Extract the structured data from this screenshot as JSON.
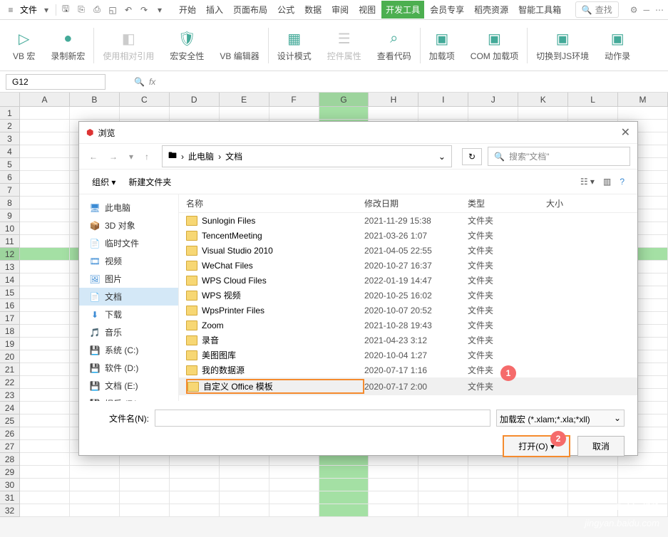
{
  "topbar": {
    "file": "文件",
    "tabs": [
      "开始",
      "插入",
      "页面布局",
      "公式",
      "数据",
      "审阅",
      "视图",
      "开发工具",
      "会员专享",
      "稻壳资源",
      "智能工具箱"
    ],
    "active_tab_index": 7,
    "search_placeholder": "查找"
  },
  "ribbon": [
    {
      "label": "VB 宏",
      "disabled": false
    },
    {
      "label": "录制新宏",
      "disabled": false
    },
    {
      "label": "使用相对引用",
      "disabled": true
    },
    {
      "label": "宏安全性",
      "disabled": false
    },
    {
      "label": "VB 编辑器",
      "disabled": false
    },
    {
      "label": "设计模式",
      "disabled": false
    },
    {
      "label": "控件属性",
      "disabled": true
    },
    {
      "label": "查看代码",
      "disabled": false
    },
    {
      "label": "加载项",
      "disabled": false
    },
    {
      "label": "COM 加载项",
      "disabled": false
    },
    {
      "label": "切换到JS环境",
      "disabled": false
    },
    {
      "label": "动作录",
      "disabled": false
    }
  ],
  "namebox": {
    "cell": "G12",
    "fx": "fx"
  },
  "columns": [
    "A",
    "B",
    "C",
    "D",
    "E",
    "F",
    "G",
    "H",
    "I",
    "J",
    "K",
    "L",
    "M"
  ],
  "active_col_index": 6,
  "active_row": 12,
  "row_count": 32,
  "dialog": {
    "title": "浏览",
    "path": {
      "root": "此电脑",
      "folder": "文档"
    },
    "search_placeholder": "搜索\"文档\"",
    "organize": "组织",
    "newfolder": "新建文件夹",
    "headers": {
      "name": "名称",
      "date": "修改日期",
      "type": "类型",
      "size": "大小"
    },
    "sidebar": [
      {
        "label": "此电脑",
        "icon": "monitor",
        "color": "#3b8bd4"
      },
      {
        "label": "3D 对象",
        "icon": "cube",
        "color": "#3b8bd4"
      },
      {
        "label": "临时文件",
        "icon": "doc",
        "color": "#3b8bd4"
      },
      {
        "label": "视频",
        "icon": "video",
        "color": "#3b8bd4"
      },
      {
        "label": "图片",
        "icon": "image",
        "color": "#3b8bd4"
      },
      {
        "label": "文档",
        "icon": "doc",
        "color": "#3b8bd4",
        "selected": true
      },
      {
        "label": "下载",
        "icon": "download",
        "color": "#3b8bd4"
      },
      {
        "label": "音乐",
        "icon": "music",
        "color": "#3b8bd4"
      },
      {
        "label": "系统 (C:)",
        "icon": "drive",
        "color": "#888"
      },
      {
        "label": "软件 (D:)",
        "icon": "drive",
        "color": "#888"
      },
      {
        "label": "文档 (E:)",
        "icon": "drive",
        "color": "#888"
      },
      {
        "label": "娱乐 (F:)",
        "icon": "drive",
        "color": "#888"
      }
    ],
    "files": [
      {
        "name": "Sunlogin Files",
        "date": "2021-11-29 15:38",
        "type": "文件夹"
      },
      {
        "name": "TencentMeeting",
        "date": "2021-03-26 1:07",
        "type": "文件夹"
      },
      {
        "name": "Visual Studio 2010",
        "date": "2021-04-05 22:55",
        "type": "文件夹"
      },
      {
        "name": "WeChat Files",
        "date": "2020-10-27 16:37",
        "type": "文件夹"
      },
      {
        "name": "WPS Cloud Files",
        "date": "2022-01-19 14:47",
        "type": "文件夹"
      },
      {
        "name": "WPS 视频",
        "date": "2020-10-25 16:02",
        "type": "文件夹"
      },
      {
        "name": "WpsPrinter Files",
        "date": "2020-10-07 20:52",
        "type": "文件夹"
      },
      {
        "name": "Zoom",
        "date": "2021-10-28 19:43",
        "type": "文件夹"
      },
      {
        "name": "录音",
        "date": "2021-04-23 3:12",
        "type": "文件夹"
      },
      {
        "name": "美图图库",
        "date": "2020-10-04 1:27",
        "type": "文件夹"
      },
      {
        "name": "我的数据源",
        "date": "2020-07-17 1:16",
        "type": "文件夹"
      },
      {
        "name": "自定义 Office 模板",
        "date": "2020-07-17 2:00",
        "type": "文件夹",
        "highlight": true
      }
    ],
    "filename_label": "文件名(N):",
    "filter": "加载宏 (*.xlam;*.xla;*xll)",
    "open_btn": "打开(O)",
    "cancel_btn": "取消",
    "marker1": "1",
    "marker2": "2"
  },
  "watermark": {
    "brand": "Baidu 经验",
    "url": "jingyan.baidu.com"
  }
}
